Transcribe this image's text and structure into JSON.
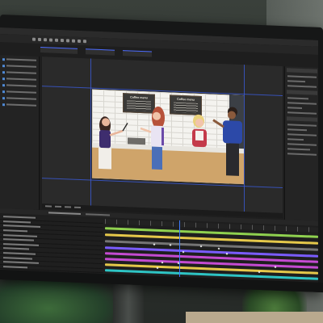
{
  "app": {
    "comp_board_left": "Coffee menu",
    "comp_board_right": "Coffee menu"
  },
  "colors": {
    "accent_blue": "#3d7bff",
    "track_green": "#8fd14f",
    "track_yellow": "#e5c84a",
    "track_magenta": "#c44bd1",
    "track_purple": "#7a5cff",
    "track_teal": "#2ec4c4",
    "counter_wood": "#cfa46a"
  },
  "icons": [
    "toolbar-tool-icon",
    "project-folder-icon"
  ]
}
